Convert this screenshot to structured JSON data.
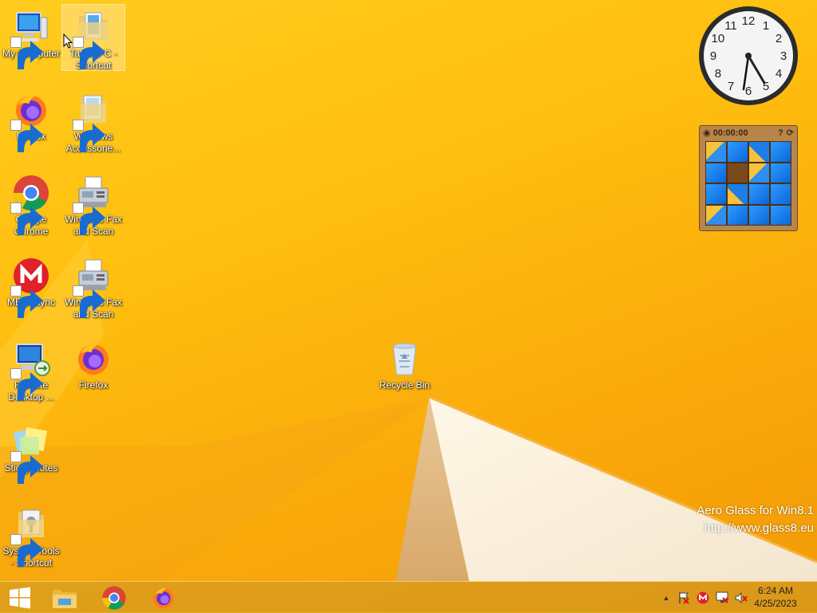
{
  "desktop": {
    "icons": [
      {
        "label": "My Computer",
        "icon": "computer-icon"
      },
      {
        "label": "Tablet PC - Shortcut",
        "icon": "folder-icon"
      },
      {
        "label": "Firefox",
        "icon": "firefox-icon"
      },
      {
        "label": "Windows Accessorie...",
        "icon": "folder-icon"
      },
      {
        "label": "Google Chrome",
        "icon": "chrome-icon"
      },
      {
        "label": "Windows Fax and Scan",
        "icon": "fax-icon"
      },
      {
        "label": "MEGAsync",
        "icon": "mega-icon"
      },
      {
        "label": "Windows Fax and Scan",
        "icon": "fax-icon"
      },
      {
        "label": "Remote Desktop ...",
        "icon": "remote-desktop-icon"
      },
      {
        "label": "Firefox",
        "icon": "firefox-icon"
      },
      {
        "label": "Sticky Notes",
        "icon": "sticky-notes-icon"
      },
      {
        "label": "System Tools - Shortcut",
        "icon": "folder-icon"
      },
      {
        "label": "Recycle Bin",
        "icon": "recycle-bin-icon"
      }
    ],
    "watermark": {
      "line1": "Aero Glass for Win8.1",
      "line2": "http://www.glass8.eu"
    }
  },
  "gadgets": {
    "clock": {
      "numbers": [
        "12",
        "1",
        "2",
        "3",
        "4",
        "5",
        "6",
        "7",
        "8",
        "9",
        "10",
        "11"
      ],
      "time": "6:24"
    },
    "puzzle": {
      "timer": "00:00:00",
      "help": "?"
    }
  },
  "taskbar": {
    "pinned": [
      "start-button",
      "file-explorer-icon",
      "chrome-icon",
      "firefox-icon"
    ],
    "tray": {
      "show_hidden": "▲",
      "time": "6:24 AM",
      "date": "4/25/2023"
    }
  },
  "colors": {
    "accent": "#ffbf10",
    "taskbar": "#c8962a"
  }
}
